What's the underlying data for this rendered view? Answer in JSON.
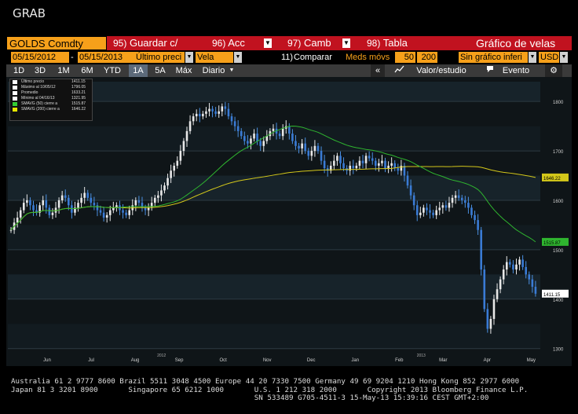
{
  "window": {
    "title": "GRAB"
  },
  "toolbar": {
    "ticker": "GOLDS Comdty",
    "buttons": [
      {
        "num": "95)",
        "label": "Guardar c/"
      },
      {
        "num": "96)",
        "label": "Acc"
      },
      {
        "num": "97)",
        "label": "Camb"
      },
      {
        "num": "98)",
        "label": "Tabla"
      }
    ],
    "chart_title": "Gráfico de velas"
  },
  "settings": {
    "start_date": "05/15/2012",
    "end_date": "05/15/2013",
    "price_field": "Último preci",
    "chart_type": "Vela",
    "compare_num": "11)",
    "compare_label": "Comparar",
    "mavg_label": "Meds móvs",
    "mavg_short": "50",
    "mavg_long": "200",
    "secondary": "Sin gráfico inferi",
    "currency": "USD"
  },
  "ranges": {
    "items": [
      "1D",
      "3D",
      "1M",
      "6M",
      "YTD",
      "1A",
      "5A",
      "Máx"
    ],
    "selected": "1A",
    "period": "Diario",
    "back_label": "«",
    "value_study": "Valor/estudio",
    "event": "Evento"
  },
  "legend": [
    {
      "label": "Último precio",
      "value": "1411.15",
      "color": "#ffffff"
    },
    {
      "label": "Máximo al 10/05/12",
      "value": "1796.05",
      "color": "#ffffff"
    },
    {
      "label": "Promedio",
      "value": "1633.21",
      "color": "#ffffff"
    },
    {
      "label": "Mínimo al 04/16/13",
      "value": "1321.95",
      "color": "#ffffff"
    },
    {
      "label": "SMAVG (50) cierre a",
      "value": "1515.87",
      "color": "#33cc33"
    },
    {
      "label": "SMAVG (200) cierre a",
      "value": "1646.22",
      "color": "#e6e600"
    }
  ],
  "chart_data": {
    "type": "candlestick",
    "y_ticks": [
      1300,
      1400,
      1500,
      1600,
      1700,
      1800
    ],
    "ylim": [
      1290,
      1840
    ],
    "x_ticks": [
      "Jun",
      "Jul",
      "Aug",
      "Sep",
      "Oct",
      "Nov",
      "Dec",
      "Jan",
      "Feb",
      "Mar",
      "Apr",
      "May"
    ],
    "year_labels": [
      "2012",
      "2013"
    ],
    "close": [
      1540,
      1555,
      1565,
      1580,
      1595,
      1600,
      1590,
      1580,
      1575,
      1590,
      1600,
      1585,
      1570,
      1575,
      1585,
      1600,
      1610,
      1605,
      1590,
      1575,
      1585,
      1595,
      1605,
      1615,
      1605,
      1595,
      1590,
      1580,
      1575,
      1565,
      1570,
      1580,
      1585,
      1590,
      1580,
      1575,
      1570,
      1580,
      1590,
      1600,
      1595,
      1585,
      1580,
      1585,
      1595,
      1605,
      1610,
      1620,
      1630,
      1645,
      1660,
      1670,
      1680,
      1700,
      1720,
      1740,
      1760,
      1770,
      1775,
      1770,
      1775,
      1780,
      1785,
      1780,
      1775,
      1780,
      1790,
      1785,
      1770,
      1760,
      1750,
      1740,
      1730,
      1720,
      1715,
      1725,
      1735,
      1720,
      1710,
      1720,
      1730,
      1740,
      1745,
      1735,
      1730,
      1745,
      1750,
      1735,
      1720,
      1710,
      1705,
      1715,
      1700,
      1690,
      1700,
      1710,
      1700,
      1680,
      1665,
      1660,
      1670,
      1680,
      1690,
      1675,
      1665,
      1660,
      1670,
      1665,
      1670,
      1680,
      1675,
      1690,
      1685,
      1680,
      1670,
      1675,
      1680,
      1665,
      1670,
      1675,
      1665,
      1660,
      1670,
      1650,
      1630,
      1610,
      1590,
      1570,
      1575,
      1585,
      1580,
      1575,
      1570,
      1580,
      1585,
      1590,
      1585,
      1595,
      1605,
      1610,
      1605,
      1600,
      1595,
      1585,
      1570,
      1560,
      1540,
      1460,
      1380,
      1340,
      1360,
      1400,
      1420,
      1440,
      1460,
      1475,
      1470,
      1460,
      1470,
      1480,
      1465,
      1450,
      1440,
      1425,
      1411
    ],
    "sma50_last": 1515.87,
    "sma200_last": 1646.22,
    "last_price": 1411.15
  },
  "price_tags": {
    "sma200": "1646.22",
    "sma50": "1515.87",
    "last": "1411.15"
  },
  "footer": {
    "line1": "Australia 61 2 9777 8600 Brazil 5511 3048 4500 Europe 44 20 7330 7500 Germany 49 69 9204 1210 Hong Kong 852 2977 6000",
    "line2": "Japan 81 3 3201 8900       Singapore 65 6212 1000       U.S. 1 212 318 2000       Copyright 2013 Bloomberg Finance L.P.",
    "line3": "                                                        SN 533489 G705-4511-3 15-May-13 15:39:16 CEST GMT+2:00"
  }
}
